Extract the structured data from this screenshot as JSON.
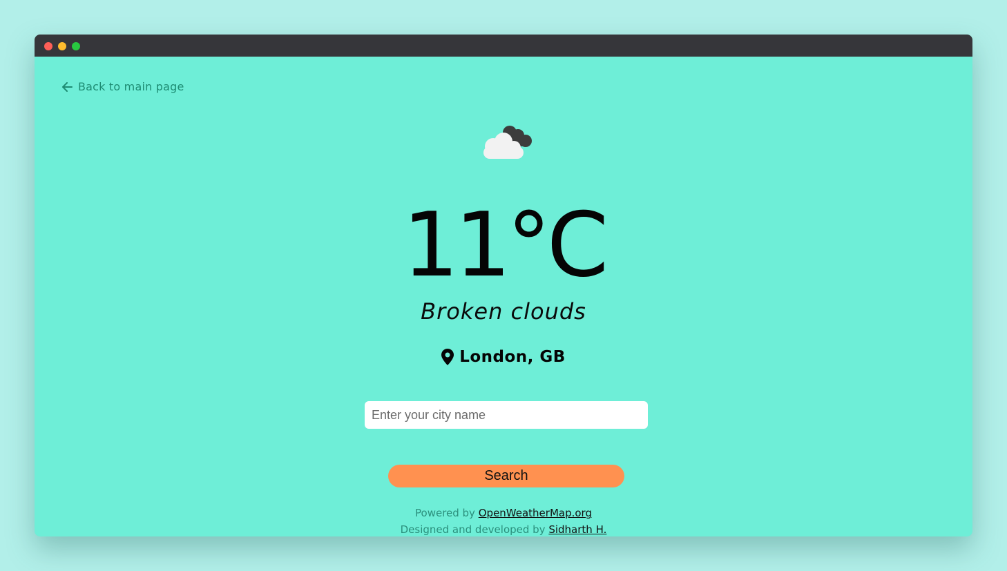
{
  "window": {
    "controls": [
      "close",
      "minimize",
      "maximize"
    ]
  },
  "nav": {
    "back_icon": "arrow-left-icon",
    "back_label": "Back to main page"
  },
  "weather": {
    "icon": "broken-clouds-icon",
    "temperature": "11°C",
    "description": "Broken clouds",
    "location_icon": "map-pin-icon",
    "location": "London, GB"
  },
  "search": {
    "placeholder": "Enter your city name",
    "value": "",
    "button_label": "Search"
  },
  "footer": {
    "powered_prefix": "Powered by",
    "powered_link": "OpenWeatherMap.org",
    "credit_prefix": "Designed and developed by",
    "credit_link": "Sidharth H."
  },
  "colors": {
    "page_background": "#b2efe9",
    "app_background": "#6eeed7",
    "titlebar": "#36363a",
    "accent_link": "#1e8c73",
    "button": "#ff9150"
  }
}
